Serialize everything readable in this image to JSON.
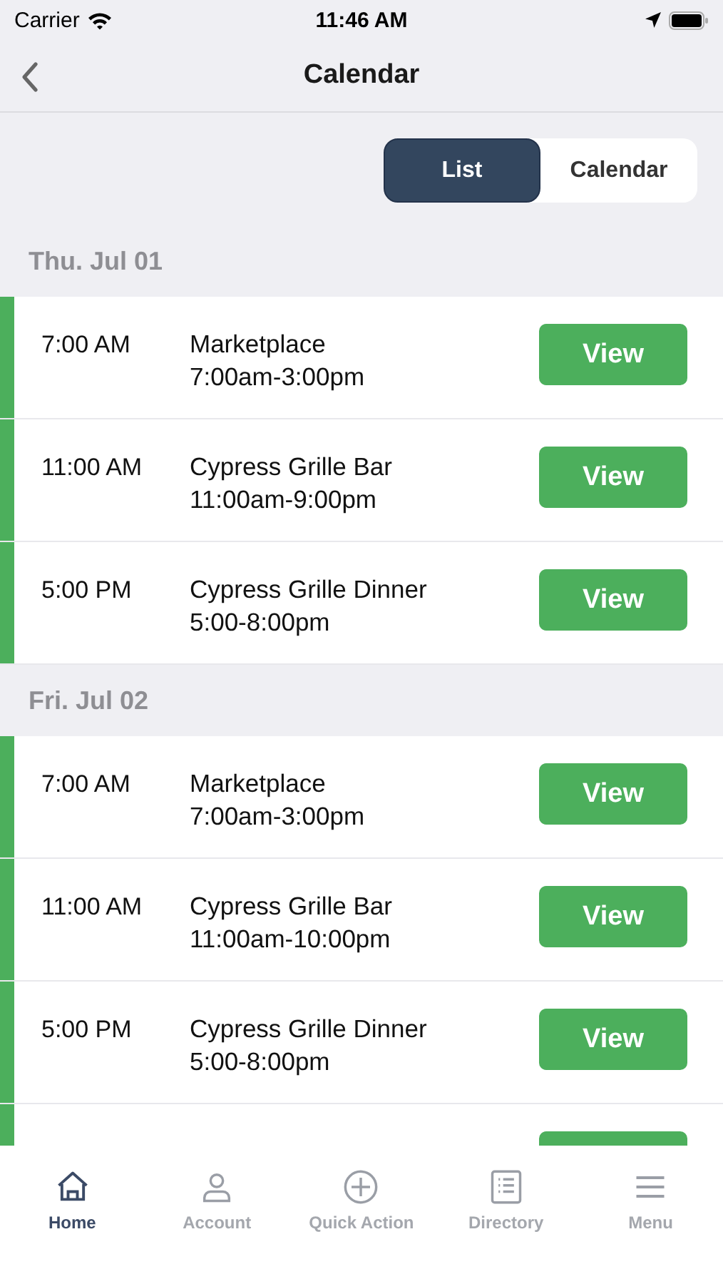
{
  "status_bar": {
    "carrier": "Carrier",
    "time": "11:46 AM"
  },
  "nav": {
    "title": "Calendar"
  },
  "view_toggle": [
    {
      "label": "List",
      "selected": true
    },
    {
      "label": "Calendar",
      "selected": false
    }
  ],
  "days": [
    {
      "date": "Thu. Jul 01",
      "events": [
        {
          "time": "7:00 AM",
          "name": "Marketplace",
          "hours": "7:00am-3:00pm",
          "button": "View"
        },
        {
          "time": "11:00 AM",
          "name": "Cypress Grille Bar",
          "hours": "11:00am-9:00pm",
          "button": "View"
        },
        {
          "time": "5:00 PM",
          "name": "Cypress Grille Dinner",
          "hours": "5:00-8:00pm",
          "button": "View"
        }
      ]
    },
    {
      "date": "Fri. Jul 02",
      "events": [
        {
          "time": "7:00 AM",
          "name": "Marketplace",
          "hours": "7:00am-3:00pm",
          "button": "View"
        },
        {
          "time": "11:00 AM",
          "name": "Cypress Grille Bar",
          "hours": "11:00am-10:00pm",
          "button": "View"
        },
        {
          "time": "5:00 PM",
          "name": "Cypress Grille Dinner",
          "hours": "5:00-8:00pm",
          "button": "View"
        },
        {
          "kind": "cut_off"
        }
      ]
    }
  ],
  "tab_bar": [
    {
      "label": "Home",
      "selected": true
    },
    {
      "label": "Account",
      "selected": false
    },
    {
      "label": "Quick Action",
      "selected": false
    },
    {
      "label": "Directory",
      "selected": false
    },
    {
      "label": "Menu",
      "selected": false
    }
  ]
}
